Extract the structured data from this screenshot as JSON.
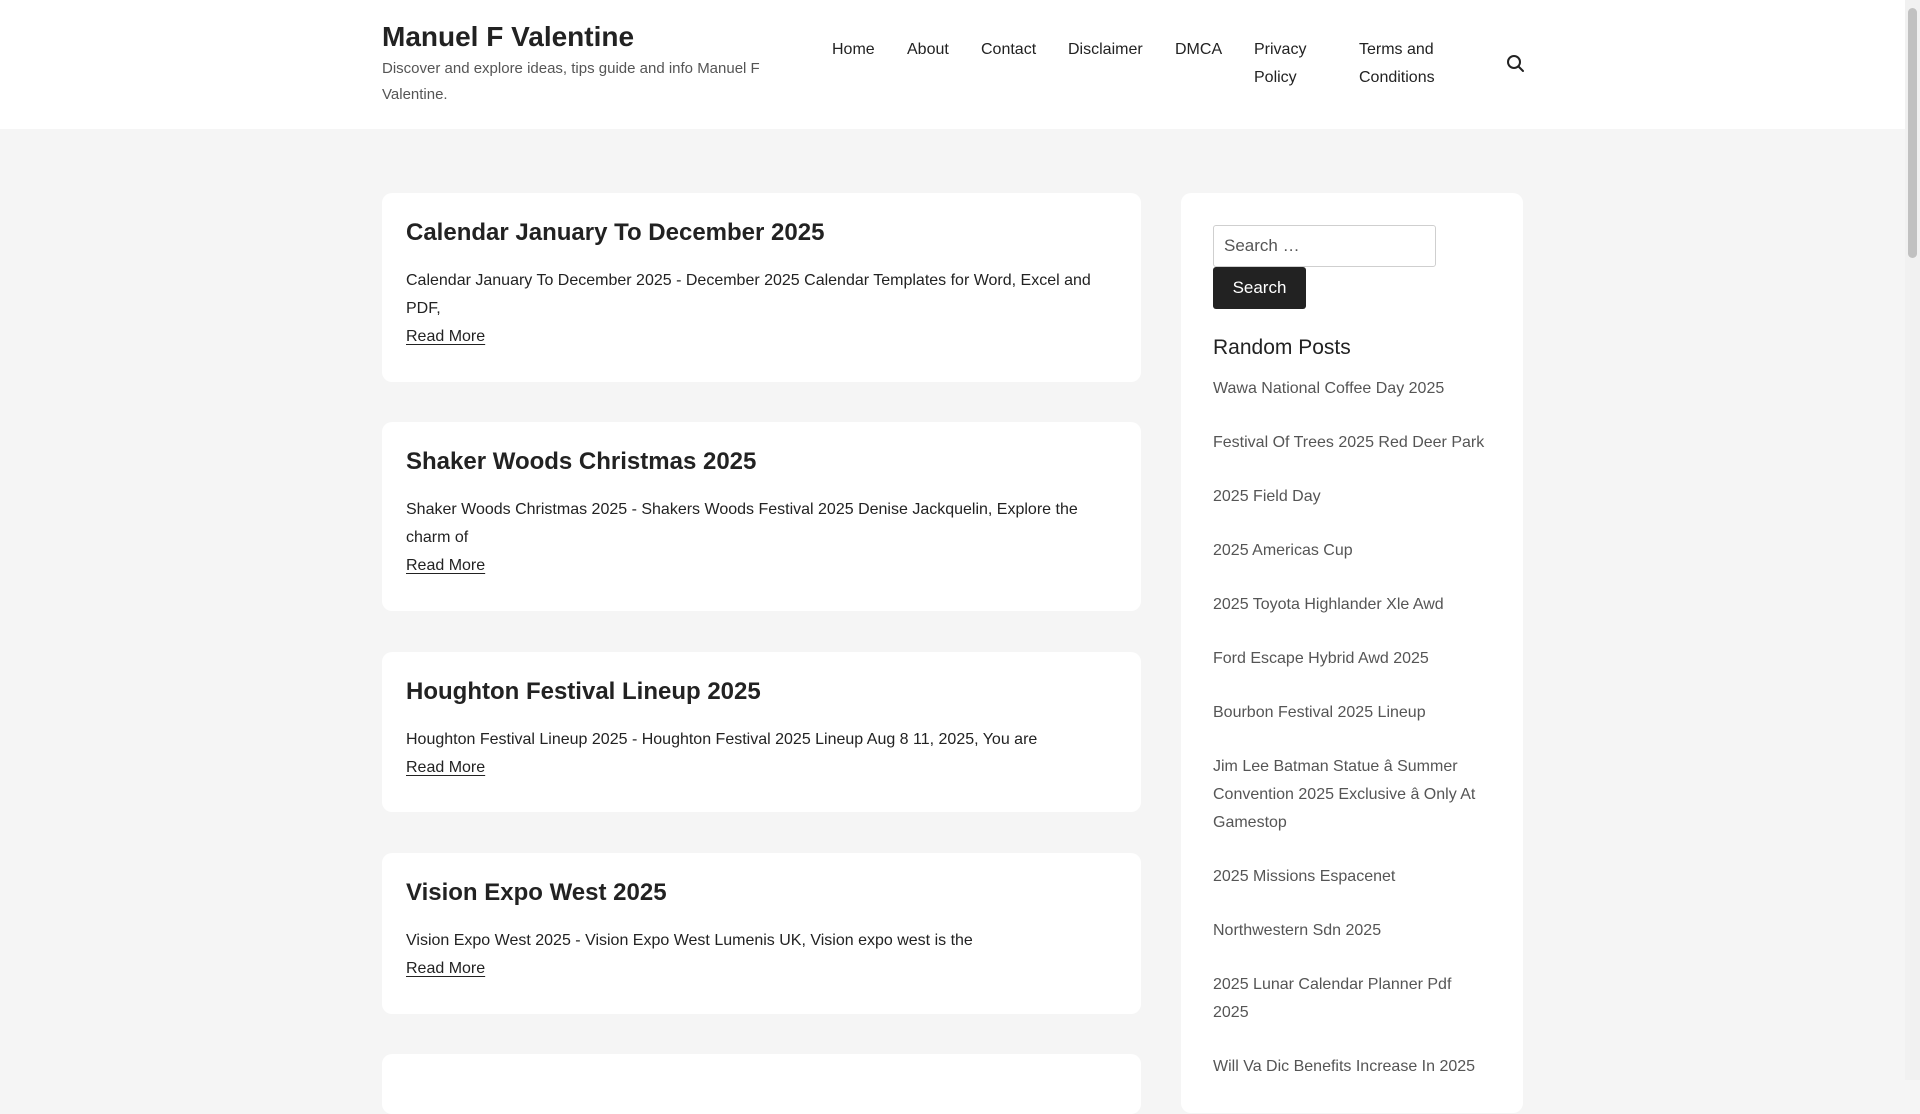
{
  "header": {
    "site_title": "Manuel F Valentine",
    "site_description": "Discover and explore ideas, tips guide and info Manuel F Valentine."
  },
  "nav": {
    "items": [
      {
        "label": "Home"
      },
      {
        "label": "About"
      },
      {
        "label": "Contact"
      },
      {
        "label": "Disclaimer"
      },
      {
        "label": "DMCA"
      },
      {
        "label": "Privacy Policy"
      },
      {
        "label": "Terms and Conditions"
      }
    ],
    "search_icon": "search-icon"
  },
  "posts": [
    {
      "title": "Calendar January To December 2025",
      "excerpt": "Calendar January To December 2025 - December 2025 Calendar Templates for Word, Excel and PDF,",
      "read_more": "Read More"
    },
    {
      "title": "Shaker Woods Christmas 2025",
      "excerpt": "Shaker Woods Christmas 2025 - Shakers Woods Festival 2025 Denise Jackquelin, Explore the charm of",
      "read_more": "Read More"
    },
    {
      "title": "Houghton Festival Lineup 2025",
      "excerpt": "Houghton Festival Lineup 2025 - Houghton Festival 2025 Lineup Aug 8 11, 2025, You are",
      "read_more": "Read More"
    },
    {
      "title": "Vision Expo West 2025",
      "excerpt": "Vision Expo West 2025 - Vision Expo West Lumenis UK, Vision expo west is the",
      "read_more": "Read More"
    }
  ],
  "sidebar": {
    "search_placeholder": "Search …",
    "search_button": "Search",
    "random_title": "Random Posts",
    "random_posts": [
      {
        "label": "Wawa National Coffee Day 2025"
      },
      {
        "label": "Festival Of Trees 2025 Red Deer Park"
      },
      {
        "label": "2025 Field Day"
      },
      {
        "label": "2025 Americas Cup"
      },
      {
        "label": "2025 Toyota Highlander Xle Awd"
      },
      {
        "label": "Ford Escape Hybrid Awd 2025"
      },
      {
        "label": "Bourbon Festival 2025 Lineup"
      },
      {
        "label": "Jim Lee Batman Statue â Summer Convention 2025 Exclusive â Only At Gamestop"
      },
      {
        "label": "2025 Missions Espacenet"
      },
      {
        "label": "Northwestern Sdn 2025"
      },
      {
        "label": "2025 Lunar Calendar Planner Pdf 2025"
      },
      {
        "label": "Will Va Dic Benefits Increase In 2025"
      }
    ]
  },
  "colors": {
    "page_background": "#f5f5f5",
    "card_background": "#ffffff",
    "text": "#222222",
    "muted_text": "#555555",
    "button_background": "#222222"
  }
}
